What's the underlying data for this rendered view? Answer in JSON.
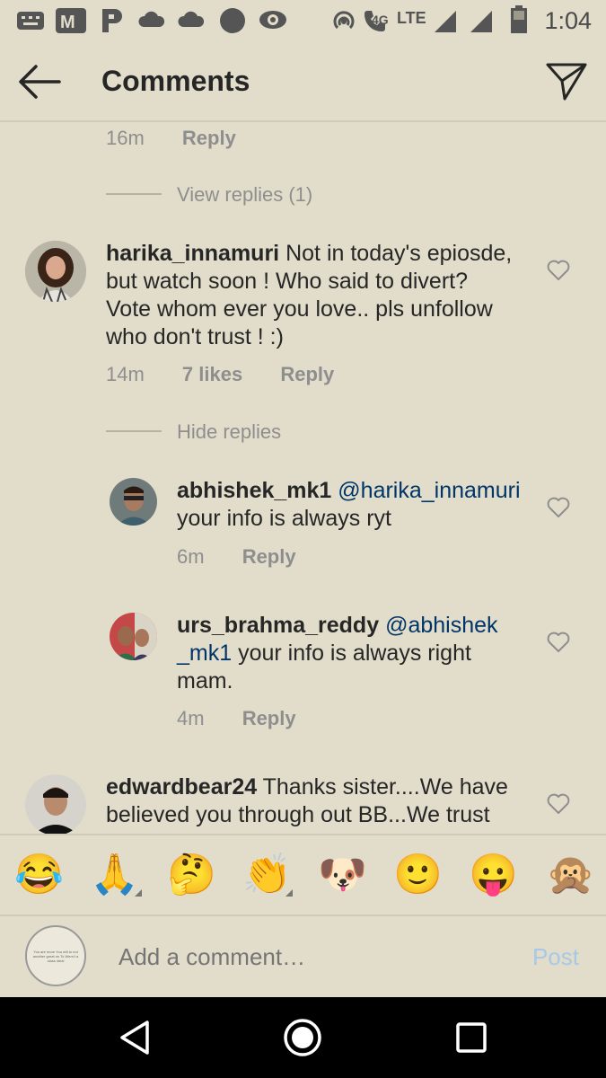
{
  "status_bar": {
    "time": "1:04",
    "network_label": "4G",
    "lte_label": "LTE",
    "icons": [
      "keyboard-icon",
      "m-app-icon",
      "p-app-icon",
      "cloud-icon",
      "cloud-icon",
      "circle-icon",
      "eye-icon",
      "hotspot-icon",
      "wifi-call-icon",
      "signal-icon",
      "signal-icon",
      "battery-icon"
    ]
  },
  "header": {
    "title": "Comments"
  },
  "thread": {
    "top_meta": {
      "time": "16m",
      "reply": "Reply"
    },
    "view_replies": "View replies (1)",
    "comment1": {
      "username": "harika_innamuri",
      "lines": [
        "Not in today's epiosde,",
        "but watch soon ! Who said to divert?",
        "Vote whom ever you love.. pls unfollow",
        "who don't trust ! :)"
      ],
      "time": "14m",
      "likes": "7 likes",
      "reply": "Reply"
    },
    "hide_replies": "Hide replies",
    "reply1": {
      "username": "abhishek_mk1",
      "mention": "@harika_innamuri",
      "text": "your info is always ryt",
      "time": "6m",
      "reply": "Reply"
    },
    "reply2": {
      "username": "urs_brahma_reddy",
      "mention_part1": "@abhishek",
      "mention_part2": "_mk1",
      "text_line2": " your info is always right",
      "text_line3": "mam.",
      "time": "4m",
      "reply": "Reply"
    },
    "comment2": {
      "username": "edwardbear24",
      "line1": " Thanks sister....We have",
      "line2": "believed you through out BB...We trust"
    }
  },
  "emoji_bar": {
    "emojis": [
      "😂",
      "🙏",
      "🤔",
      "👏",
      "🐶",
      "🙂",
      "😛",
      "🙊"
    ]
  },
  "composer": {
    "placeholder": "Add a comment…",
    "post_label": "Post",
    "avatar_text": "You are more You will to not another great on To Wern't a class ideal"
  },
  "colors": {
    "background": "#e1ddca",
    "mention": "#003569",
    "meta": "#8e8e8e",
    "post": "#a8c8e8"
  }
}
